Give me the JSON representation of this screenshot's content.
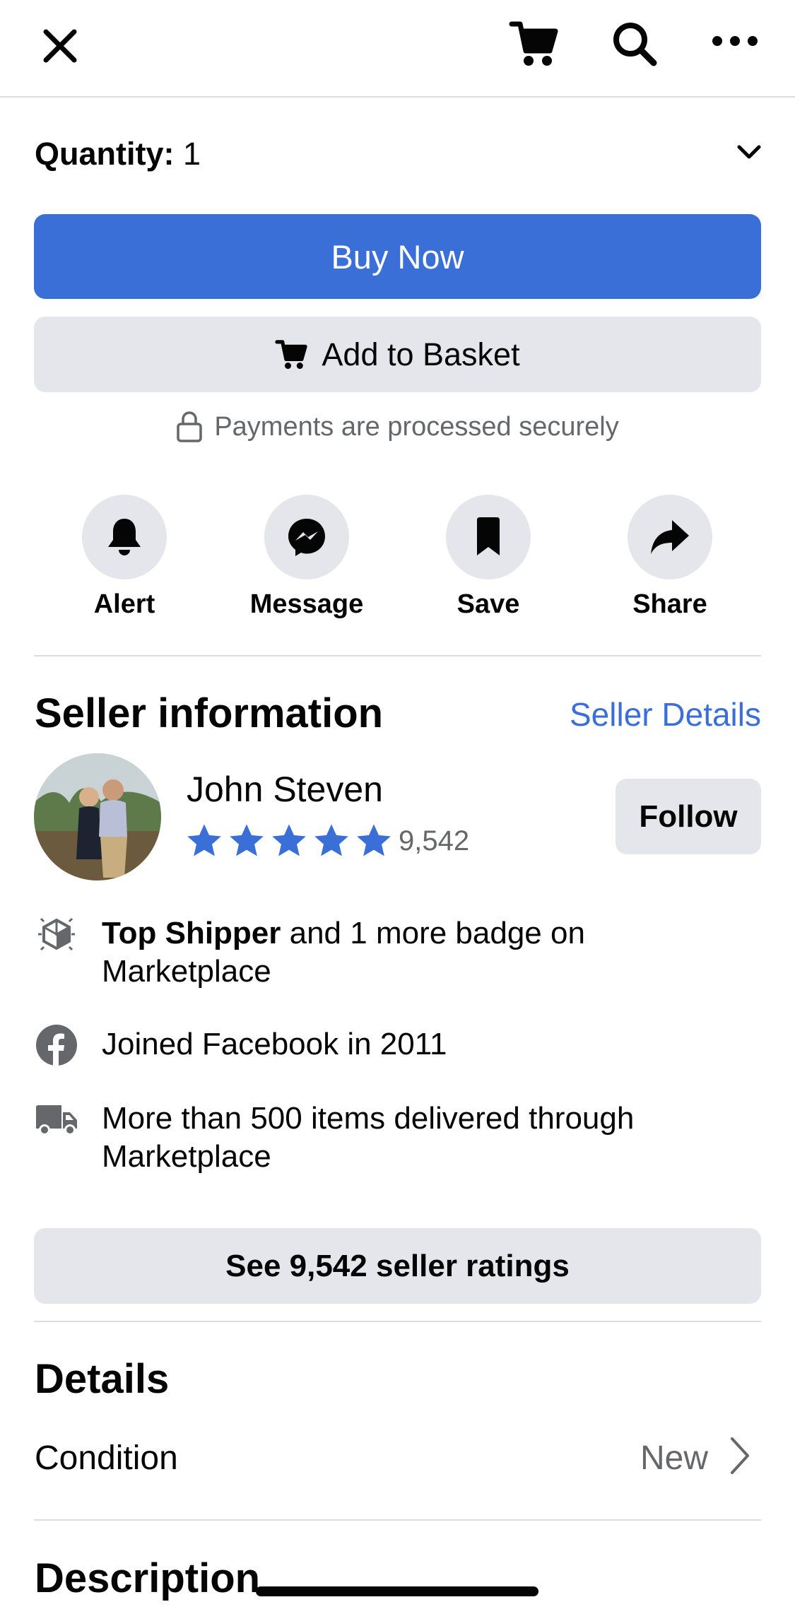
{
  "topbar": {
    "close_icon": "close-icon",
    "cart_icon": "cart-icon",
    "search_icon": "search-icon",
    "more_icon": "more-icon"
  },
  "quantity": {
    "label": "Quantity:",
    "value": "1"
  },
  "buy_now_label": "Buy Now",
  "add_to_basket_label": "Add to Basket",
  "secure_text": "Payments are processed securely",
  "actions": [
    {
      "label": "Alert",
      "icon": "bell-icon"
    },
    {
      "label": "Message",
      "icon": "messenger-icon"
    },
    {
      "label": "Save",
      "icon": "bookmark-icon"
    },
    {
      "label": "Share",
      "icon": "share-icon"
    }
  ],
  "seller": {
    "heading": "Seller information",
    "details_link": "Seller Details",
    "name": "John Steven",
    "rating_stars": 5,
    "rating_count": "9,542",
    "follow_label": "Follow",
    "badge_bold": "Top Shipper",
    "badge_rest": " and 1 more badge on Marketplace",
    "joined": "Joined Facebook in 2011",
    "delivered": "More than 500 items delivered through Marketplace",
    "see_ratings": "See 9,542 seller ratings"
  },
  "details": {
    "heading": "Details",
    "condition_label": "Condition",
    "condition_value": "New"
  },
  "description_heading": "Description",
  "colors": {
    "accent": "#3a6fd8",
    "button_gray": "#e4e6eb",
    "secondary_text": "#65676b"
  }
}
